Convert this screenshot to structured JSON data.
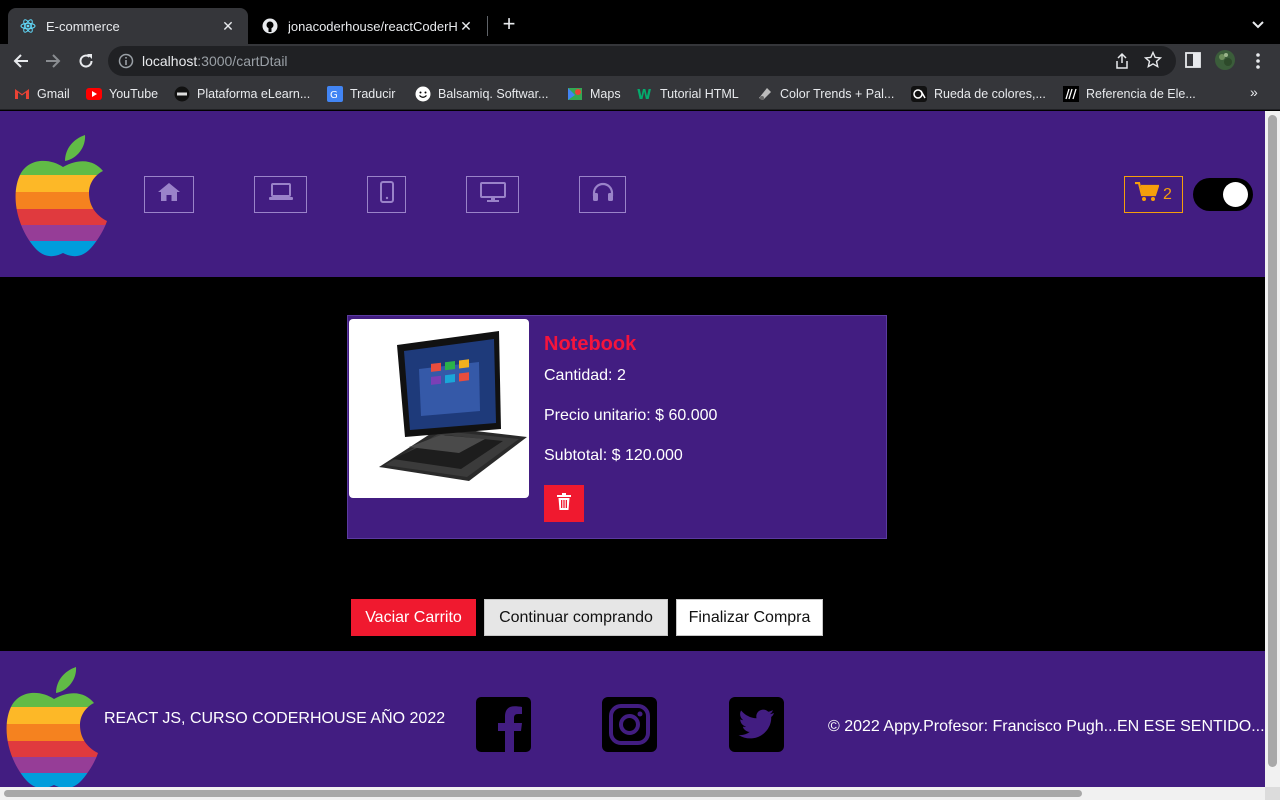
{
  "browser": {
    "tabs": [
      {
        "title": "E-commerce",
        "icon": "react-icon",
        "active": true
      },
      {
        "title": "jonacoderhouse/reactCoderHo",
        "icon": "github-icon",
        "active": false
      }
    ],
    "url_host": "localhost",
    "url_path": ":3000/cartDtail",
    "bookmarks": [
      {
        "label": "Gmail",
        "icon": "gmail-icon"
      },
      {
        "label": "YouTube",
        "icon": "youtube-icon"
      },
      {
        "label": "Plataforma eLearn...",
        "icon": "coder-icon"
      },
      {
        "label": "Traducir",
        "icon": "translate-icon"
      },
      {
        "label": "Balsamiq. Softwar...",
        "icon": "balsamiq-icon"
      },
      {
        "label": "Maps",
        "icon": "maps-icon"
      },
      {
        "label": "Tutorial HTML",
        "icon": "w3-icon"
      },
      {
        "label": "Color Trends + Pal...",
        "icon": "palette-icon"
      },
      {
        "label": "Rueda de colores,...",
        "icon": "color-wheel-icon"
      },
      {
        "label": "Referencia de Ele...",
        "icon": "mdn-icon"
      }
    ],
    "more_bookmarks": "»"
  },
  "header": {
    "nav_icons": [
      "home-icon",
      "laptop-icon",
      "phone-icon",
      "monitor-icon",
      "headphones-icon"
    ],
    "cart_count": "2"
  },
  "cart": {
    "product_name": "Notebook",
    "quantity": "Cantidad: 2",
    "unit_price": "Precio unitario: $ 60.000",
    "subtotal": "Subtotal: $ 120.000"
  },
  "actions": {
    "clear": "Vaciar Carrito",
    "continue": "Continuar comprando",
    "finish": "Finalizar Compra"
  },
  "footer": {
    "text": "REACT JS, CURSO CODERHOUSE AÑO 2022",
    "copyright": "© 2022 Appy.Profesor: Francisco Pugh...EN ESE SENTIDO...",
    "social_icons": [
      "facebook-icon",
      "instagram-icon",
      "twitter-icon"
    ]
  },
  "colors": {
    "header_bg": "#421d81",
    "danger": "#f0192f",
    "cart_accent": "#f59e0b"
  }
}
